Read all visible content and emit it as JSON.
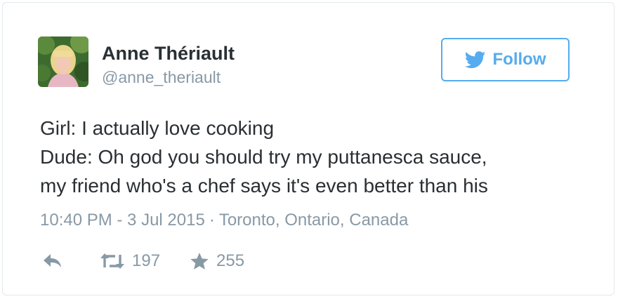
{
  "author": {
    "display_name": "Anne Thériault",
    "handle": "@anne_theriault",
    "avatar_icon": "profile-photo"
  },
  "follow_button": {
    "label": "Follow",
    "icon": "twitter-bird-icon",
    "color": "#55acee"
  },
  "tweet": {
    "lines": [
      "Girl: I actually love cooking",
      "Dude: Oh god you should try my puttanesca sauce,",
      "my friend who's a chef says it's even better than his"
    ]
  },
  "meta": {
    "timestamp": "10:40 PM - 3 Jul 2015",
    "separator": "·",
    "location": "Toronto, Ontario, Canada"
  },
  "actions": {
    "reply_icon": "reply-icon",
    "retweet_icon": "retweet-icon",
    "retweet_count": "197",
    "like_icon": "star-icon",
    "like_count": "255"
  },
  "colors": {
    "text": "#292f33",
    "muted": "#8899a6",
    "accent": "#55acee",
    "border": "#e1e8ed"
  }
}
